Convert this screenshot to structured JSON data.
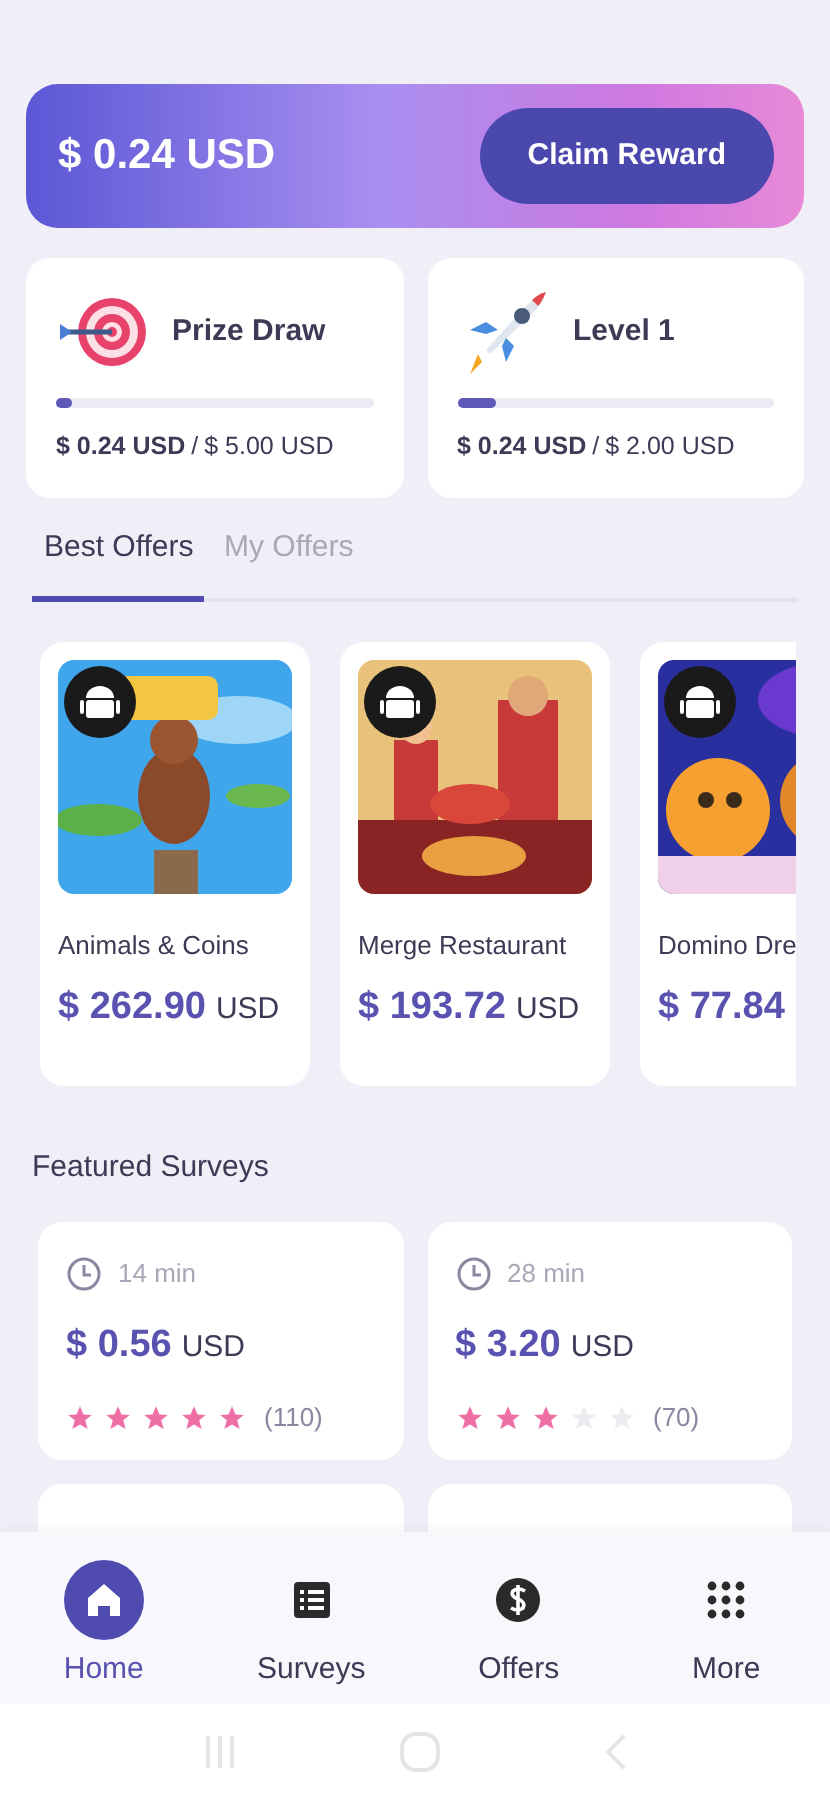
{
  "balance": {
    "amount": "$ 0.24 USD",
    "button": "Claim Reward"
  },
  "goals": [
    {
      "kind": "target",
      "title": "Prize Draw",
      "level": 0.05,
      "current": "$ 0.24 USD",
      "separator": "/",
      "goal": "$ 5.00 USD"
    },
    {
      "kind": "rocket",
      "title": "Level 1",
      "level": 0.12,
      "current": "$ 0.24 USD",
      "separator": "/",
      "goal": "$ 2.00 USD"
    }
  ],
  "tabs": [
    {
      "label": "Best Offers",
      "selected": true
    },
    {
      "label": "My Offers",
      "selected": false
    }
  ],
  "offers": [
    {
      "kind": "picture",
      "name": "Animals & Coins",
      "price": "$ 262.90",
      "currency": "USD"
    },
    {
      "kind": "picture",
      "name": "Merge Restaurant",
      "price": "$ 193.72",
      "currency": "USD"
    },
    {
      "kind": "picture",
      "name": "Domino Dre",
      "price": "$ 77.84"
    }
  ],
  "surveys_title": "Featured Surveys",
  "surveys": [
    {
      "time": "14 min",
      "price": "$ 0.56",
      "currency": "USD",
      "stars": 5,
      "count": "(110)"
    },
    {
      "time": "28 min",
      "price": "$ 3.20",
      "currency": "USD",
      "stars": 3,
      "count": "(70)"
    }
  ],
  "nav": [
    {
      "kind": "home",
      "label": "Home",
      "selected": true
    },
    {
      "kind": "list",
      "label": "Surveys",
      "selected": false
    },
    {
      "kind": "dollar",
      "label": "Offers",
      "selected": false
    },
    {
      "kind": "grid",
      "label": "More",
      "selected": false
    }
  ]
}
